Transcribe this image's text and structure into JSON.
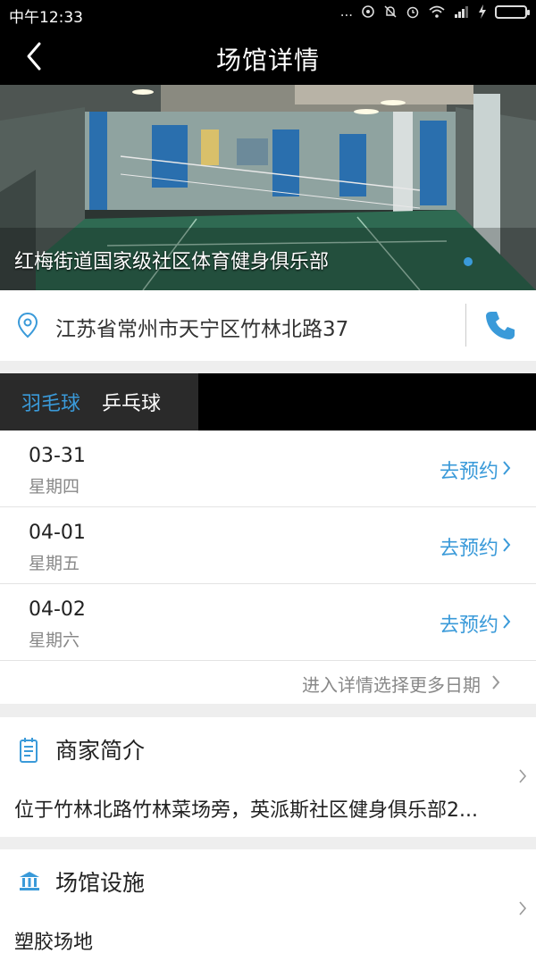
{
  "status_bar": {
    "time": "中午12:33",
    "signal_dots": "..."
  },
  "nav": {
    "title": "场馆详情"
  },
  "venue": {
    "name": "红梅街道国家级社区体育健身俱乐部",
    "address": "江苏省常州市天宁区竹林北路37"
  },
  "sport_tabs": [
    {
      "label": "羽毛球",
      "selected": true
    },
    {
      "label": "乒乓球",
      "selected": false
    }
  ],
  "dates": [
    {
      "date": "03-31",
      "weekday": "星期四",
      "action": "去预约"
    },
    {
      "date": "04-01",
      "weekday": "星期五",
      "action": "去预约"
    },
    {
      "date": "04-02",
      "weekday": "星期六",
      "action": "去预约"
    }
  ],
  "more_dates_label": "进入详情选择更多日期",
  "intro": {
    "title": "商家简介",
    "text": "位于竹林北路竹林菜场旁，英派斯社区健身俱乐部2..."
  },
  "facilities": {
    "title": "场馆设施",
    "text": "塑胶场地"
  },
  "colors": {
    "accent": "#3a9ad9",
    "bar": "#000000",
    "tab_bg": "#2a2a2a"
  },
  "icons": [
    "back-icon",
    "location-pin-icon",
    "phone-icon",
    "chevron-right-icon",
    "notepad-icon",
    "building-icon"
  ]
}
